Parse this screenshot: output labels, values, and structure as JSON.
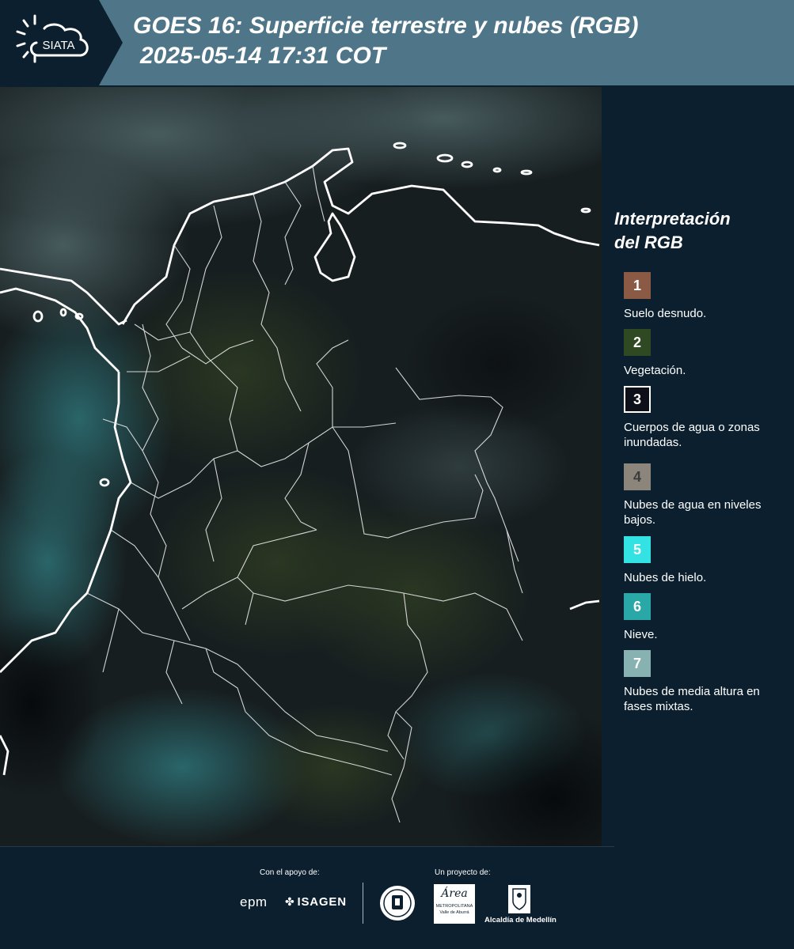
{
  "header": {
    "logo_text": "SIATA",
    "title_line1": "GOES 16: Superficie terrestre y nubes (RGB)",
    "title_line2": "2025-05-14 17:31 COT"
  },
  "map": {
    "icon": "satellite-composite-map"
  },
  "legend": {
    "title_line1": "Interpretación",
    "title_line2": "del RGB",
    "items": [
      {
        "num": "1",
        "label": "Suelo desnudo.",
        "color": "#8a5a45",
        "num_color": "#ffffff"
      },
      {
        "num": "2",
        "label": "Vegetación.",
        "color": "#2f4a22",
        "num_color": "#ffffff"
      },
      {
        "num": "3",
        "label": "Cuerpos de agua o zonas inundadas.",
        "color": "#0d1018",
        "num_color": "#ffffff"
      },
      {
        "num": "4",
        "label": "Nubes de agua en niveles bajos.",
        "color": "#8b857c",
        "num_color": "#3c3c3c"
      },
      {
        "num": "5",
        "label": "Nubes de hielo.",
        "color": "#33e3e3",
        "num_color": "#ffffff"
      },
      {
        "num": "6",
        "label": "Nieve.",
        "color": "#2aa7a7",
        "num_color": "#ffffff"
      },
      {
        "num": "7",
        "label": "Nubes de media altura en fases mixtas.",
        "color": "#88b2b2",
        "num_color": "#ffffff"
      }
    ]
  },
  "footer": {
    "support_label": "Con el apoyo de:",
    "project_label": "Un proyecto de:",
    "epm": "epm",
    "isagen": "ISAGEN",
    "amva_name": "Área",
    "amva_sub1": "METROPOLITANA",
    "amva_sub2": "Valle de Aburrá",
    "alcaldia": "Alcaldía de Medellín"
  }
}
